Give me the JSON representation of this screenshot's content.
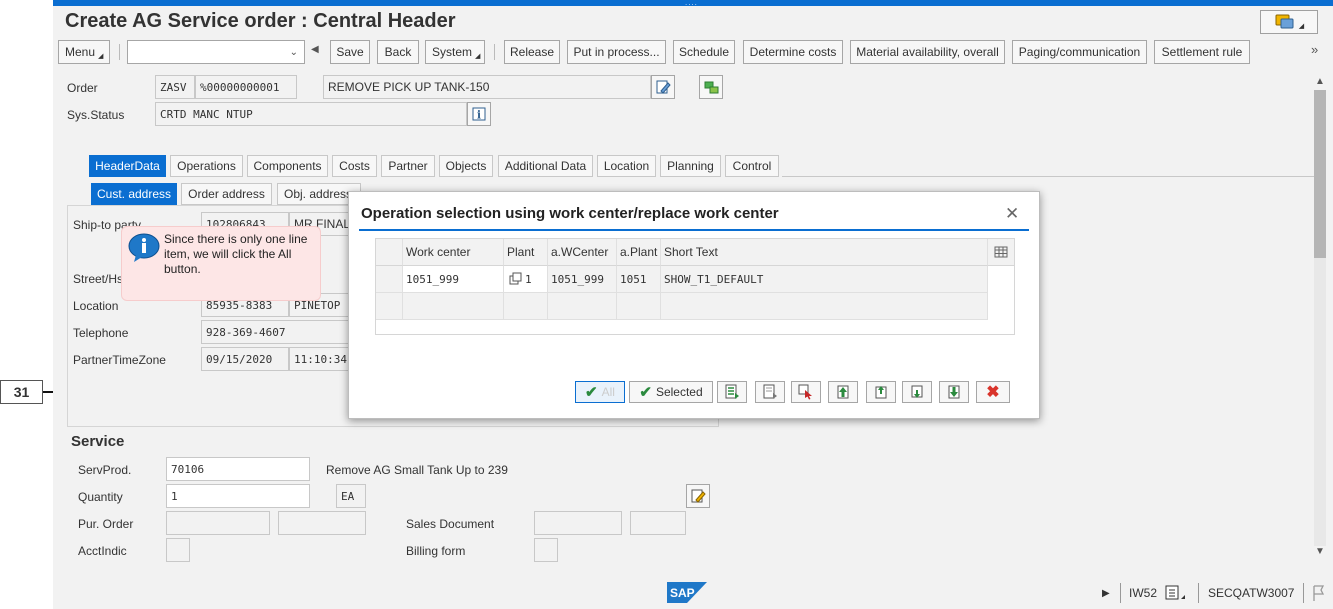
{
  "window": {
    "title": "Create AG Service order : Central Header"
  },
  "toolbar": {
    "menu": "Menu",
    "command_field_value": "",
    "buttons": [
      "Save",
      "Back",
      "System",
      "Release",
      "Put in process...",
      "Schedule",
      "Determine costs",
      "Material availability, overall",
      "Paging/communication",
      "Settlement rule"
    ],
    "more": "»"
  },
  "header": {
    "order_label": "Order",
    "order_type": "ZASV",
    "order_number": "%00000000001",
    "order_description": "REMOVE PICK UP TANK-150",
    "status_label": "Sys.Status",
    "status_value": "CRTD MANC NTUP"
  },
  "tabs": [
    "HeaderData",
    "Operations",
    "Components",
    "Costs",
    "Partner",
    "Objects",
    "Additional Data",
    "Location",
    "Planning",
    "Control"
  ],
  "subtabs": [
    "Cust. address",
    "Order address",
    "Obj. address"
  ],
  "address": {
    "shipto_label": "Ship-to party",
    "shipto_number": "102806843",
    "shipto_name": "MR FINAL",
    "street_label": "Street/Hs",
    "location_label": "Location",
    "location_zip": "85935-8383",
    "location_city": "PINETOP",
    "telephone_label": "Telephone",
    "telephone_value": "928-369-4607",
    "tz_label": "PartnerTimeZone",
    "tz_date": "09/15/2020",
    "tz_time": "11:10:34"
  },
  "service": {
    "title": "Service",
    "servprod_label": "ServProd.",
    "servprod_value": "70106",
    "servprod_text": "Remove AG Small Tank Up to 239",
    "quantity_label": "Quantity",
    "quantity_value": "1",
    "quantity_unit": "EA",
    "purorder_label": "Pur. Order",
    "salesdoc_label": "Sales Document",
    "acctindic_label": "AcctIndic",
    "billing_label": "Billing form"
  },
  "callout": {
    "text": "Since there is only one line item, we will click the All button."
  },
  "dialog": {
    "title": "Operation selection using work center/replace work center",
    "close": "✕",
    "columns": [
      "Work center",
      "Plant",
      "a.WCenter",
      "a.Plant",
      "Short Text"
    ],
    "rows": [
      {
        "work_center": "1051_999",
        "plant": "1",
        "a_wcenter": "1051_999",
        "a_plant": "1051",
        "short_text": "SHOW_T1_DEFAULT"
      }
    ],
    "btn_all": "All",
    "btn_selected": "Selected"
  },
  "statusbar": {
    "sap": "SAP",
    "transaction": "IW52",
    "system": "SECQATW3007"
  },
  "annotation": {
    "step": "31"
  },
  "colors": {
    "accent": "#0a6ed1",
    "callout_bg": "#fde6e6",
    "close_red": "#d9342b",
    "ok_green": "#2b8a3e"
  }
}
